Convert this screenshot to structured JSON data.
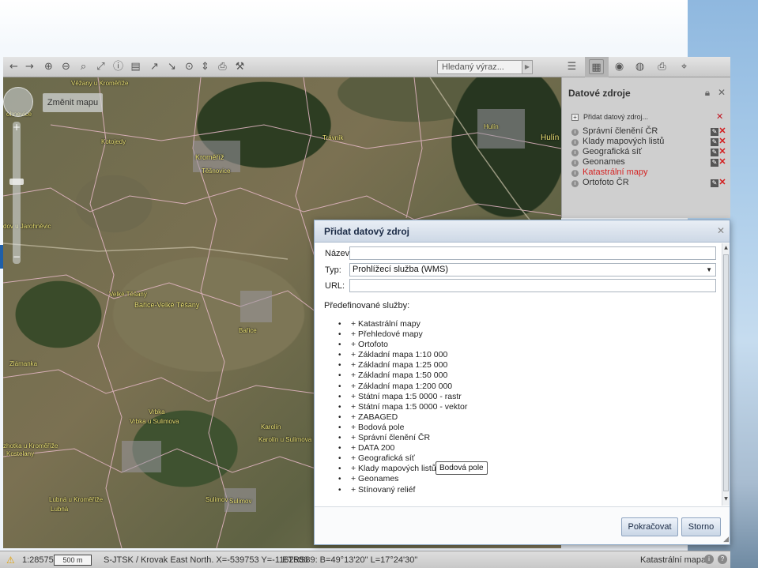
{
  "toolbar": {
    "search_placeholder": "Hledaný výraz...",
    "icons": [
      "arrow-left-icon",
      "arrow-right-icon",
      "zoom-in-icon",
      "zoom-out-icon",
      "zoom-box-icon",
      "zoom-extent-icon",
      "info-icon",
      "print-preview-icon",
      "measure-length-icon",
      "measure-area-icon",
      "measure-icon",
      "ruler-icon",
      "print-icon",
      "settings-wrench-icon",
      "layers-icon",
      "data-sources-icon",
      "legend-icon",
      "globe-icon",
      "print-icon",
      "search-tool-icon"
    ]
  },
  "map": {
    "change_map_label": "Změnit mapu",
    "labels": [
      {
        "text": "Věžany u Kroměříže"
      },
      {
        "text": "Kotojedy"
      },
      {
        "text": "Kroměříž"
      },
      {
        "text": "Těšnovice"
      },
      {
        "text": "Trávník"
      },
      {
        "text": "Hulín"
      },
      {
        "text": "Hulín"
      },
      {
        "text": "ohnevice"
      },
      {
        "text": "dov u Jarohněvic"
      },
      {
        "text": "Velké Těšany"
      },
      {
        "text": "Bařice-Velké Těšany"
      },
      {
        "text": "Bařice"
      },
      {
        "text": "Zlámanka"
      },
      {
        "text": "Vrbka"
      },
      {
        "text": "Vrbka u Sulimova"
      },
      {
        "text": "Karolín"
      },
      {
        "text": "Karolín u Sulimova"
      },
      {
        "text": "zhotka u Kroměříže"
      },
      {
        "text": "Kostelany"
      },
      {
        "text": "Lubná u Kroměříže"
      },
      {
        "text": "Lubná"
      },
      {
        "text": "Sulimov"
      },
      {
        "text": "Sulimov"
      }
    ]
  },
  "panel": {
    "title": "Datové zdroje",
    "add_label": "Přidat datový zdroj...",
    "layers": [
      {
        "name": "Správní členění ČR",
        "error": false,
        "editable": true
      },
      {
        "name": "Klady mapových listů",
        "error": false,
        "editable": true
      },
      {
        "name": "Geografická síť",
        "error": false,
        "editable": true
      },
      {
        "name": "Geonames",
        "error": false,
        "editable": true
      },
      {
        "name": "Katastrální mapy",
        "error": true,
        "editable": false
      },
      {
        "name": "Ortofoto ČR",
        "error": false,
        "editable": true
      }
    ]
  },
  "dialog": {
    "title": "Přidat datový zdroj",
    "name_label": "Název:",
    "name_value": "",
    "type_label": "Typ:",
    "type_value": "Prohlížecí služba (WMS)",
    "url_label": "URL:",
    "url_value": "",
    "predefined_label": "Předefinované služby:",
    "services": [
      "+ Katastrální mapy",
      "+ Přehledové mapy",
      "+ Ortofoto",
      "+ Základní mapa 1:10 000",
      "+ Základní mapa 1:25 000",
      "+ Základní mapa 1:50 000",
      "+ Základní mapa 1:200 000",
      "+ Státní mapa 1:5 0000 - rastr",
      "+ Státní mapa 1:5 0000 - vektor",
      "+ ZABAGED",
      "+ Bodová pole",
      "+ Správní členění ČR",
      "+ DATA 200",
      "+ Geografická síť",
      "+ Klady mapových listů",
      "+ Geonames",
      "+ Stínovaný reliéf"
    ],
    "tooltip": "Bodová pole",
    "continue_label": "Pokračovat",
    "cancel_label": "Storno"
  },
  "status": {
    "scale": "1:28575",
    "scalebar": "500 m",
    "coordinates": "S-JTSK / Krovak East North. X=-539753 Y=-1162586",
    "etrs": "ETRS89: B=49°13'20\" L=17°24'30\"",
    "active_layer": "Katastrální mapa"
  },
  "colors": {
    "error_red": "#d42424",
    "dialog_header": "#cdd8e6",
    "map_label": "#f3e97a"
  }
}
